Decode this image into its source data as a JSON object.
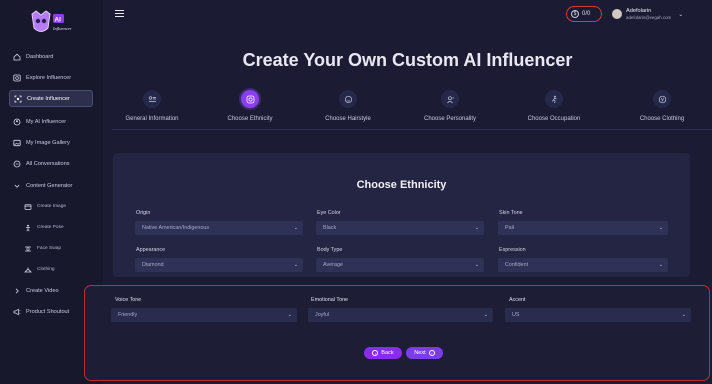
{
  "app": {
    "logo_text": "AI Influencer"
  },
  "sidebar": {
    "items": [
      {
        "label": "Dashboard"
      },
      {
        "label": "Explore Influencer"
      },
      {
        "label": "Create Influencer"
      },
      {
        "label": "My AI Influencer"
      },
      {
        "label": "My Image Gallery"
      },
      {
        "label": "All Conversations"
      },
      {
        "label": "Content Generator"
      },
      {
        "label": "Create Image"
      },
      {
        "label": "Create Pose"
      },
      {
        "label": "Face Swap"
      },
      {
        "label": "Clothing"
      },
      {
        "label": "Create Video"
      },
      {
        "label": "Product Shoutout"
      }
    ]
  },
  "header": {
    "credits": "0/0",
    "user_name": "Adefolarin",
    "user_email": "adefolarin@vegah.com"
  },
  "page": {
    "title": "Create Your Own Custom AI Influencer"
  },
  "steps": [
    {
      "label": "General Information",
      "icon": "sliders-icon"
    },
    {
      "label": "Choose Ethnicity",
      "icon": "globe-icon"
    },
    {
      "label": "Choose Hairstyle",
      "icon": "face-icon"
    },
    {
      "label": "Choose Personality",
      "icon": "person-icon"
    },
    {
      "label": "Choose Occupation",
      "icon": "runner-icon"
    },
    {
      "label": "Choose Clothing",
      "icon": "shirt-icon"
    }
  ],
  "form": {
    "title": "Choose Ethnicity",
    "origin": {
      "label": "Origin",
      "value": "Native American/Indigenous"
    },
    "eye_color": {
      "label": "Eye Color",
      "value": "Black"
    },
    "skin_tone": {
      "label": "Skin Tone",
      "value": "Pail"
    },
    "appearance": {
      "label": "Appearance",
      "value": "Diamond"
    },
    "body_type": {
      "label": "Body Type",
      "value": "Average"
    },
    "expression": {
      "label": "Expression",
      "value": "Confident"
    },
    "voice_tone": {
      "label": "Voice Tone",
      "value": "Friendly"
    },
    "emotional_tone": {
      "label": "Emotional Tone",
      "value": "Joyful"
    },
    "accent": {
      "label": "Accent",
      "value": "US"
    }
  },
  "buttons": {
    "back": "Back",
    "next": "Next"
  },
  "colors": {
    "accent": "#8a3ef0",
    "highlight_border": "#c22a2f"
  }
}
